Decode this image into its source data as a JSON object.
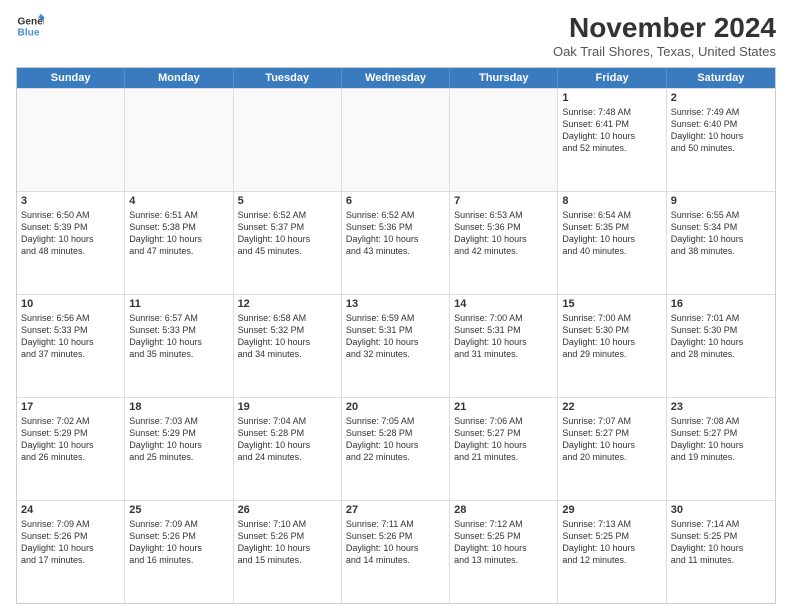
{
  "header": {
    "logo_line1": "General",
    "logo_line2": "Blue",
    "month": "November 2024",
    "location": "Oak Trail Shores, Texas, United States"
  },
  "weekdays": [
    "Sunday",
    "Monday",
    "Tuesday",
    "Wednesday",
    "Thursday",
    "Friday",
    "Saturday"
  ],
  "rows": [
    [
      {
        "day": "",
        "text": "",
        "empty": true
      },
      {
        "day": "",
        "text": "",
        "empty": true
      },
      {
        "day": "",
        "text": "",
        "empty": true
      },
      {
        "day": "",
        "text": "",
        "empty": true
      },
      {
        "day": "",
        "text": "",
        "empty": true
      },
      {
        "day": "1",
        "text": "Sunrise: 7:48 AM\nSunset: 6:41 PM\nDaylight: 10 hours\nand 52 minutes.",
        "empty": false
      },
      {
        "day": "2",
        "text": "Sunrise: 7:49 AM\nSunset: 6:40 PM\nDaylight: 10 hours\nand 50 minutes.",
        "empty": false
      }
    ],
    [
      {
        "day": "3",
        "text": "Sunrise: 6:50 AM\nSunset: 5:39 PM\nDaylight: 10 hours\nand 48 minutes.",
        "empty": false
      },
      {
        "day": "4",
        "text": "Sunrise: 6:51 AM\nSunset: 5:38 PM\nDaylight: 10 hours\nand 47 minutes.",
        "empty": false
      },
      {
        "day": "5",
        "text": "Sunrise: 6:52 AM\nSunset: 5:37 PM\nDaylight: 10 hours\nand 45 minutes.",
        "empty": false
      },
      {
        "day": "6",
        "text": "Sunrise: 6:52 AM\nSunset: 5:36 PM\nDaylight: 10 hours\nand 43 minutes.",
        "empty": false
      },
      {
        "day": "7",
        "text": "Sunrise: 6:53 AM\nSunset: 5:36 PM\nDaylight: 10 hours\nand 42 minutes.",
        "empty": false
      },
      {
        "day": "8",
        "text": "Sunrise: 6:54 AM\nSunset: 5:35 PM\nDaylight: 10 hours\nand 40 minutes.",
        "empty": false
      },
      {
        "day": "9",
        "text": "Sunrise: 6:55 AM\nSunset: 5:34 PM\nDaylight: 10 hours\nand 38 minutes.",
        "empty": false
      }
    ],
    [
      {
        "day": "10",
        "text": "Sunrise: 6:56 AM\nSunset: 5:33 PM\nDaylight: 10 hours\nand 37 minutes.",
        "empty": false
      },
      {
        "day": "11",
        "text": "Sunrise: 6:57 AM\nSunset: 5:33 PM\nDaylight: 10 hours\nand 35 minutes.",
        "empty": false
      },
      {
        "day": "12",
        "text": "Sunrise: 6:58 AM\nSunset: 5:32 PM\nDaylight: 10 hours\nand 34 minutes.",
        "empty": false
      },
      {
        "day": "13",
        "text": "Sunrise: 6:59 AM\nSunset: 5:31 PM\nDaylight: 10 hours\nand 32 minutes.",
        "empty": false
      },
      {
        "day": "14",
        "text": "Sunrise: 7:00 AM\nSunset: 5:31 PM\nDaylight: 10 hours\nand 31 minutes.",
        "empty": false
      },
      {
        "day": "15",
        "text": "Sunrise: 7:00 AM\nSunset: 5:30 PM\nDaylight: 10 hours\nand 29 minutes.",
        "empty": false
      },
      {
        "day": "16",
        "text": "Sunrise: 7:01 AM\nSunset: 5:30 PM\nDaylight: 10 hours\nand 28 minutes.",
        "empty": false
      }
    ],
    [
      {
        "day": "17",
        "text": "Sunrise: 7:02 AM\nSunset: 5:29 PM\nDaylight: 10 hours\nand 26 minutes.",
        "empty": false
      },
      {
        "day": "18",
        "text": "Sunrise: 7:03 AM\nSunset: 5:29 PM\nDaylight: 10 hours\nand 25 minutes.",
        "empty": false
      },
      {
        "day": "19",
        "text": "Sunrise: 7:04 AM\nSunset: 5:28 PM\nDaylight: 10 hours\nand 24 minutes.",
        "empty": false
      },
      {
        "day": "20",
        "text": "Sunrise: 7:05 AM\nSunset: 5:28 PM\nDaylight: 10 hours\nand 22 minutes.",
        "empty": false
      },
      {
        "day": "21",
        "text": "Sunrise: 7:06 AM\nSunset: 5:27 PM\nDaylight: 10 hours\nand 21 minutes.",
        "empty": false
      },
      {
        "day": "22",
        "text": "Sunrise: 7:07 AM\nSunset: 5:27 PM\nDaylight: 10 hours\nand 20 minutes.",
        "empty": false
      },
      {
        "day": "23",
        "text": "Sunrise: 7:08 AM\nSunset: 5:27 PM\nDaylight: 10 hours\nand 19 minutes.",
        "empty": false
      }
    ],
    [
      {
        "day": "24",
        "text": "Sunrise: 7:09 AM\nSunset: 5:26 PM\nDaylight: 10 hours\nand 17 minutes.",
        "empty": false
      },
      {
        "day": "25",
        "text": "Sunrise: 7:09 AM\nSunset: 5:26 PM\nDaylight: 10 hours\nand 16 minutes.",
        "empty": false
      },
      {
        "day": "26",
        "text": "Sunrise: 7:10 AM\nSunset: 5:26 PM\nDaylight: 10 hours\nand 15 minutes.",
        "empty": false
      },
      {
        "day": "27",
        "text": "Sunrise: 7:11 AM\nSunset: 5:26 PM\nDaylight: 10 hours\nand 14 minutes.",
        "empty": false
      },
      {
        "day": "28",
        "text": "Sunrise: 7:12 AM\nSunset: 5:25 PM\nDaylight: 10 hours\nand 13 minutes.",
        "empty": false
      },
      {
        "day": "29",
        "text": "Sunrise: 7:13 AM\nSunset: 5:25 PM\nDaylight: 10 hours\nand 12 minutes.",
        "empty": false
      },
      {
        "day": "30",
        "text": "Sunrise: 7:14 AM\nSunset: 5:25 PM\nDaylight: 10 hours\nand 11 minutes.",
        "empty": false
      }
    ]
  ]
}
